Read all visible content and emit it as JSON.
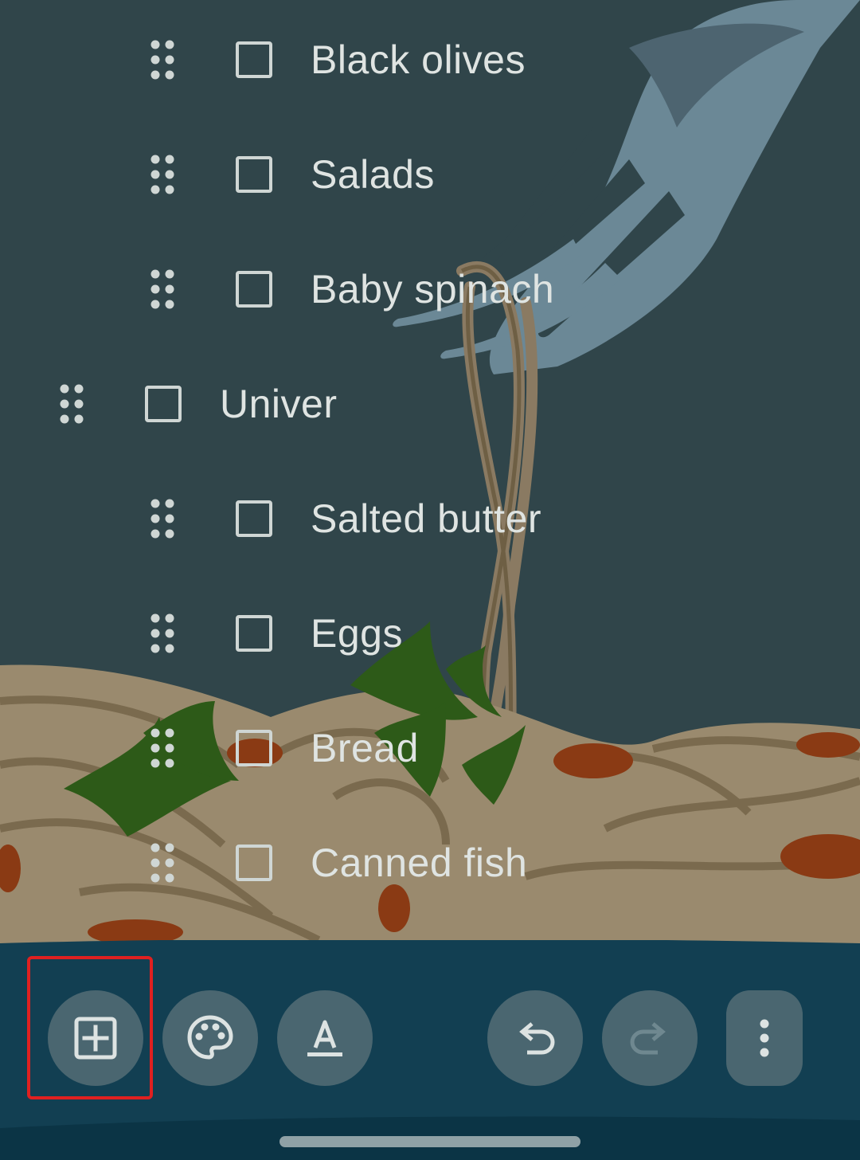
{
  "checklist": {
    "items": [
      {
        "label": "Black olives",
        "checked": false,
        "indent": true
      },
      {
        "label": "Salads",
        "checked": false,
        "indent": true
      },
      {
        "label": "Baby spinach",
        "checked": false,
        "indent": true
      },
      {
        "label": "Univer",
        "checked": false,
        "indent": false
      },
      {
        "label": "Salted butter",
        "checked": false,
        "indent": true
      },
      {
        "label": "Eggs",
        "checked": false,
        "indent": true
      },
      {
        "label": "Bread",
        "checked": false,
        "indent": true
      },
      {
        "label": "Canned fish",
        "checked": false,
        "indent": true
      }
    ]
  },
  "toolbar": {
    "buttons": [
      {
        "name": "add-box-icon",
        "action": "add"
      },
      {
        "name": "palette-icon",
        "action": "background options"
      },
      {
        "name": "text-format-icon",
        "action": "formatting"
      },
      {
        "name": "undo-icon",
        "action": "undo"
      },
      {
        "name": "redo-icon",
        "action": "redo",
        "enabled": false
      },
      {
        "name": "more-vert-icon",
        "action": "more"
      }
    ]
  },
  "colors": {
    "background": "#30454a",
    "toolbar": "#123f52",
    "highlight": "#e02020",
    "text": "#dfe4e2"
  }
}
